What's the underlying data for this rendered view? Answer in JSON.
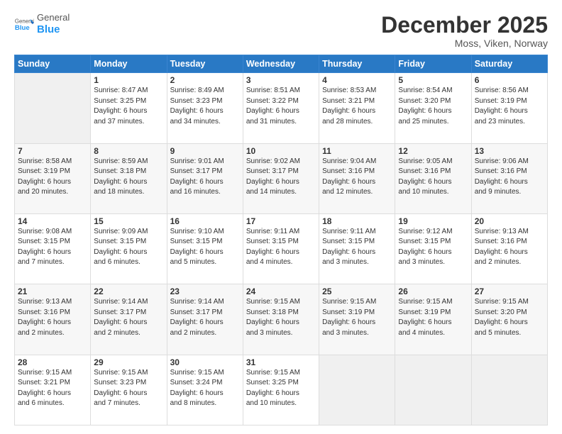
{
  "logo": {
    "general": "General",
    "blue": "Blue"
  },
  "header": {
    "month_year": "December 2025",
    "location": "Moss, Viken, Norway"
  },
  "days_of_week": [
    "Sunday",
    "Monday",
    "Tuesday",
    "Wednesday",
    "Thursday",
    "Friday",
    "Saturday"
  ],
  "weeks": [
    [
      {
        "num": "",
        "info": ""
      },
      {
        "num": "1",
        "info": "Sunrise: 8:47 AM\nSunset: 3:25 PM\nDaylight: 6 hours\nand 37 minutes."
      },
      {
        "num": "2",
        "info": "Sunrise: 8:49 AM\nSunset: 3:23 PM\nDaylight: 6 hours\nand 34 minutes."
      },
      {
        "num": "3",
        "info": "Sunrise: 8:51 AM\nSunset: 3:22 PM\nDaylight: 6 hours\nand 31 minutes."
      },
      {
        "num": "4",
        "info": "Sunrise: 8:53 AM\nSunset: 3:21 PM\nDaylight: 6 hours\nand 28 minutes."
      },
      {
        "num": "5",
        "info": "Sunrise: 8:54 AM\nSunset: 3:20 PM\nDaylight: 6 hours\nand 25 minutes."
      },
      {
        "num": "6",
        "info": "Sunrise: 8:56 AM\nSunset: 3:19 PM\nDaylight: 6 hours\nand 23 minutes."
      }
    ],
    [
      {
        "num": "7",
        "info": "Sunrise: 8:58 AM\nSunset: 3:19 PM\nDaylight: 6 hours\nand 20 minutes."
      },
      {
        "num": "8",
        "info": "Sunrise: 8:59 AM\nSunset: 3:18 PM\nDaylight: 6 hours\nand 18 minutes."
      },
      {
        "num": "9",
        "info": "Sunrise: 9:01 AM\nSunset: 3:17 PM\nDaylight: 6 hours\nand 16 minutes."
      },
      {
        "num": "10",
        "info": "Sunrise: 9:02 AM\nSunset: 3:17 PM\nDaylight: 6 hours\nand 14 minutes."
      },
      {
        "num": "11",
        "info": "Sunrise: 9:04 AM\nSunset: 3:16 PM\nDaylight: 6 hours\nand 12 minutes."
      },
      {
        "num": "12",
        "info": "Sunrise: 9:05 AM\nSunset: 3:16 PM\nDaylight: 6 hours\nand 10 minutes."
      },
      {
        "num": "13",
        "info": "Sunrise: 9:06 AM\nSunset: 3:16 PM\nDaylight: 6 hours\nand 9 minutes."
      }
    ],
    [
      {
        "num": "14",
        "info": "Sunrise: 9:08 AM\nSunset: 3:15 PM\nDaylight: 6 hours\nand 7 minutes."
      },
      {
        "num": "15",
        "info": "Sunrise: 9:09 AM\nSunset: 3:15 PM\nDaylight: 6 hours\nand 6 minutes."
      },
      {
        "num": "16",
        "info": "Sunrise: 9:10 AM\nSunset: 3:15 PM\nDaylight: 6 hours\nand 5 minutes."
      },
      {
        "num": "17",
        "info": "Sunrise: 9:11 AM\nSunset: 3:15 PM\nDaylight: 6 hours\nand 4 minutes."
      },
      {
        "num": "18",
        "info": "Sunrise: 9:11 AM\nSunset: 3:15 PM\nDaylight: 6 hours\nand 3 minutes."
      },
      {
        "num": "19",
        "info": "Sunrise: 9:12 AM\nSunset: 3:15 PM\nDaylight: 6 hours\nand 3 minutes."
      },
      {
        "num": "20",
        "info": "Sunrise: 9:13 AM\nSunset: 3:16 PM\nDaylight: 6 hours\nand 2 minutes."
      }
    ],
    [
      {
        "num": "21",
        "info": "Sunrise: 9:13 AM\nSunset: 3:16 PM\nDaylight: 6 hours\nand 2 minutes."
      },
      {
        "num": "22",
        "info": "Sunrise: 9:14 AM\nSunset: 3:17 PM\nDaylight: 6 hours\nand 2 minutes."
      },
      {
        "num": "23",
        "info": "Sunrise: 9:14 AM\nSunset: 3:17 PM\nDaylight: 6 hours\nand 2 minutes."
      },
      {
        "num": "24",
        "info": "Sunrise: 9:15 AM\nSunset: 3:18 PM\nDaylight: 6 hours\nand 3 minutes."
      },
      {
        "num": "25",
        "info": "Sunrise: 9:15 AM\nSunset: 3:19 PM\nDaylight: 6 hours\nand 3 minutes."
      },
      {
        "num": "26",
        "info": "Sunrise: 9:15 AM\nSunset: 3:19 PM\nDaylight: 6 hours\nand 4 minutes."
      },
      {
        "num": "27",
        "info": "Sunrise: 9:15 AM\nSunset: 3:20 PM\nDaylight: 6 hours\nand 5 minutes."
      }
    ],
    [
      {
        "num": "28",
        "info": "Sunrise: 9:15 AM\nSunset: 3:21 PM\nDaylight: 6 hours\nand 6 minutes."
      },
      {
        "num": "29",
        "info": "Sunrise: 9:15 AM\nSunset: 3:23 PM\nDaylight: 6 hours\nand 7 minutes."
      },
      {
        "num": "30",
        "info": "Sunrise: 9:15 AM\nSunset: 3:24 PM\nDaylight: 6 hours\nand 8 minutes."
      },
      {
        "num": "31",
        "info": "Sunrise: 9:15 AM\nSunset: 3:25 PM\nDaylight: 6 hours\nand 10 minutes."
      },
      {
        "num": "",
        "info": ""
      },
      {
        "num": "",
        "info": ""
      },
      {
        "num": "",
        "info": ""
      }
    ]
  ]
}
